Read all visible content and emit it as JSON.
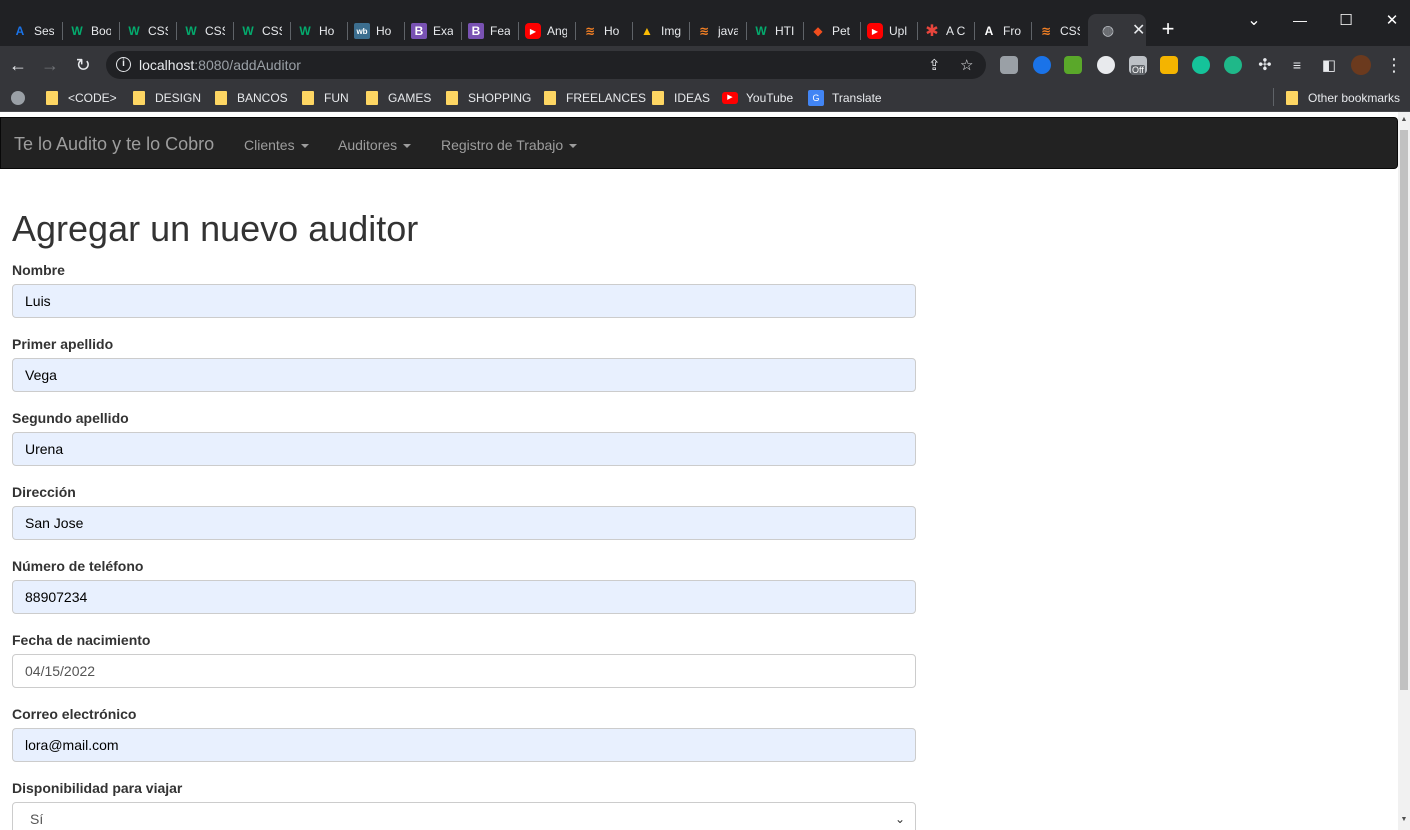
{
  "browser": {
    "tabs": [
      {
        "label": "Ses",
        "icon": "a-logo-icon",
        "color": "#1a73e8"
      },
      {
        "label": "Boo",
        "icon": "w-logo-icon",
        "color": "#04aa6d"
      },
      {
        "label": "CSS",
        "icon": "w-logo-icon",
        "color": "#04aa6d"
      },
      {
        "label": "CSS",
        "icon": "w-logo-icon",
        "color": "#04aa6d"
      },
      {
        "label": "CSS",
        "icon": "w-logo-icon",
        "color": "#04aa6d"
      },
      {
        "label": "Ho",
        "icon": "w-logo-icon",
        "color": "#04aa6d"
      },
      {
        "label": "Ho",
        "icon": "wb-logo-icon",
        "color": "#3c6e8f"
      },
      {
        "label": "Exa",
        "icon": "bootstrap-icon",
        "color": "#7952b3"
      },
      {
        "label": "Fea",
        "icon": "bootstrap-icon",
        "color": "#7952b3"
      },
      {
        "label": "Ang",
        "icon": "youtube-icon",
        "color": "#ff0000"
      },
      {
        "label": "Ho",
        "icon": "stackoverflow-icon",
        "color": "#f48024"
      },
      {
        "label": "Img",
        "icon": "drive-icon",
        "color": "#fbbc04"
      },
      {
        "label": "java",
        "icon": "stackoverflow-icon",
        "color": "#f48024"
      },
      {
        "label": "HTI",
        "icon": "w-logo-icon",
        "color": "#04aa6d"
      },
      {
        "label": "Pet",
        "icon": "figma-icon",
        "color": "#f24e1e"
      },
      {
        "label": "Upl",
        "icon": "youtube-icon",
        "color": "#ff0000"
      },
      {
        "label": "A C",
        "icon": "asterisk-icon",
        "color": "#e8453c"
      },
      {
        "label": "Fro",
        "icon": "a-logo-icon",
        "color": "#ffffff"
      },
      {
        "label": "CSS",
        "icon": "stackoverflow-icon",
        "color": "#f48024"
      }
    ],
    "new_tab": "+",
    "window_controls": {
      "minimize": "—",
      "maximize": "☐",
      "close": "✕",
      "tab_search": "⌄"
    },
    "address": {
      "host": "localhost",
      "rest": ":8080/addAuditor"
    },
    "bookmarks": [
      {
        "label": "<CODE>"
      },
      {
        "label": "DESIGN"
      },
      {
        "label": "BANCOS"
      },
      {
        "label": "FUN"
      },
      {
        "label": "GAMES"
      },
      {
        "label": "SHOPPING"
      },
      {
        "label": "FREELANCES"
      },
      {
        "label": "IDEAS"
      },
      {
        "label": "YouTube"
      },
      {
        "label": "Translate"
      }
    ],
    "other_bookmarks": "Other bookmarks",
    "extension_off_badge": "Off"
  },
  "app": {
    "brand": "Te lo Audito y te lo Cobro",
    "menu": [
      "Clientes",
      "Auditores",
      "Registro de Trabajo"
    ]
  },
  "form": {
    "title": "Agregar un nuevo auditor",
    "fields": [
      {
        "label": "Nombre",
        "value": "Luis"
      },
      {
        "label": "Primer apellido",
        "value": "Vega"
      },
      {
        "label": "Segundo apellido",
        "value": "Urena"
      },
      {
        "label": "Dirección",
        "value": "San Jose"
      },
      {
        "label": "Número de teléfono",
        "value": "88907234"
      },
      {
        "label": "Fecha de nacimiento",
        "value": "04/15/2022"
      },
      {
        "label": "Correo electrónico",
        "value": "lora@mail.com"
      },
      {
        "label": "Disponibilidad para viajar",
        "value": "Sí"
      }
    ]
  }
}
